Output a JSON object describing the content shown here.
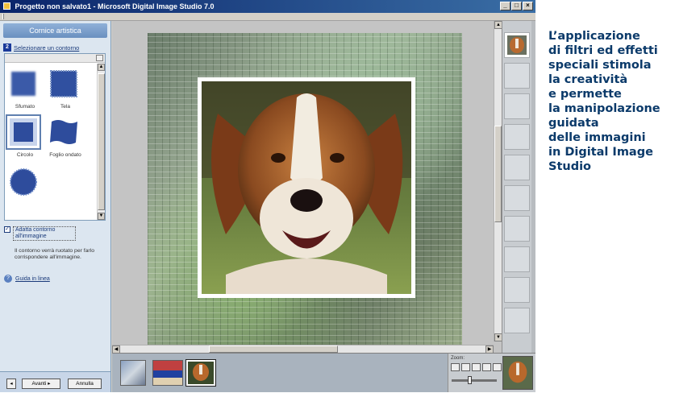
{
  "window": {
    "title": "Progetto non salvato1 - Microsoft Digital Image Studio 7.0",
    "controls": [
      "_",
      "□",
      "×"
    ]
  },
  "task_panel": {
    "header": "Cornice artistica",
    "step_number": "2",
    "step_label": "Selezionare un contorno",
    "shapes": [
      {
        "label": "Sfumato",
        "icon": "blur-edge-icon"
      },
      {
        "label": "Tela",
        "icon": "canvas-edge-icon"
      },
      {
        "label": "Circolo",
        "icon": "circle-edge-icon",
        "selected": true
      },
      {
        "label": "Foglio ondato",
        "icon": "wavy-sheet-icon"
      },
      {
        "label": "",
        "icon": "starburst-edge-icon"
      }
    ],
    "checkbox_label": "Adatta contorno all'immagine",
    "checkbox_checked": true,
    "info_text": "Il contorno verrà ruotato per farlo corrispondere all'immagine.",
    "help_label": "Guida in linea",
    "back_label": "◂",
    "next_label": "Avanti ▸",
    "cancel_label": "Annulla"
  },
  "zoom": {
    "label": "Zoom:"
  },
  "caption": [
    "L’applicazione",
    "di filtri ed effetti",
    "speciali stimola",
    "la creatività",
    "e permette",
    "la manipolazione",
    "guidata",
    "delle immagini",
    "in Digital Image",
    "Studio"
  ],
  "colors": {
    "title_bar": "#0a246a",
    "task_panel_bg": "#dce6f0",
    "caption_text": "#0b3a6a"
  }
}
